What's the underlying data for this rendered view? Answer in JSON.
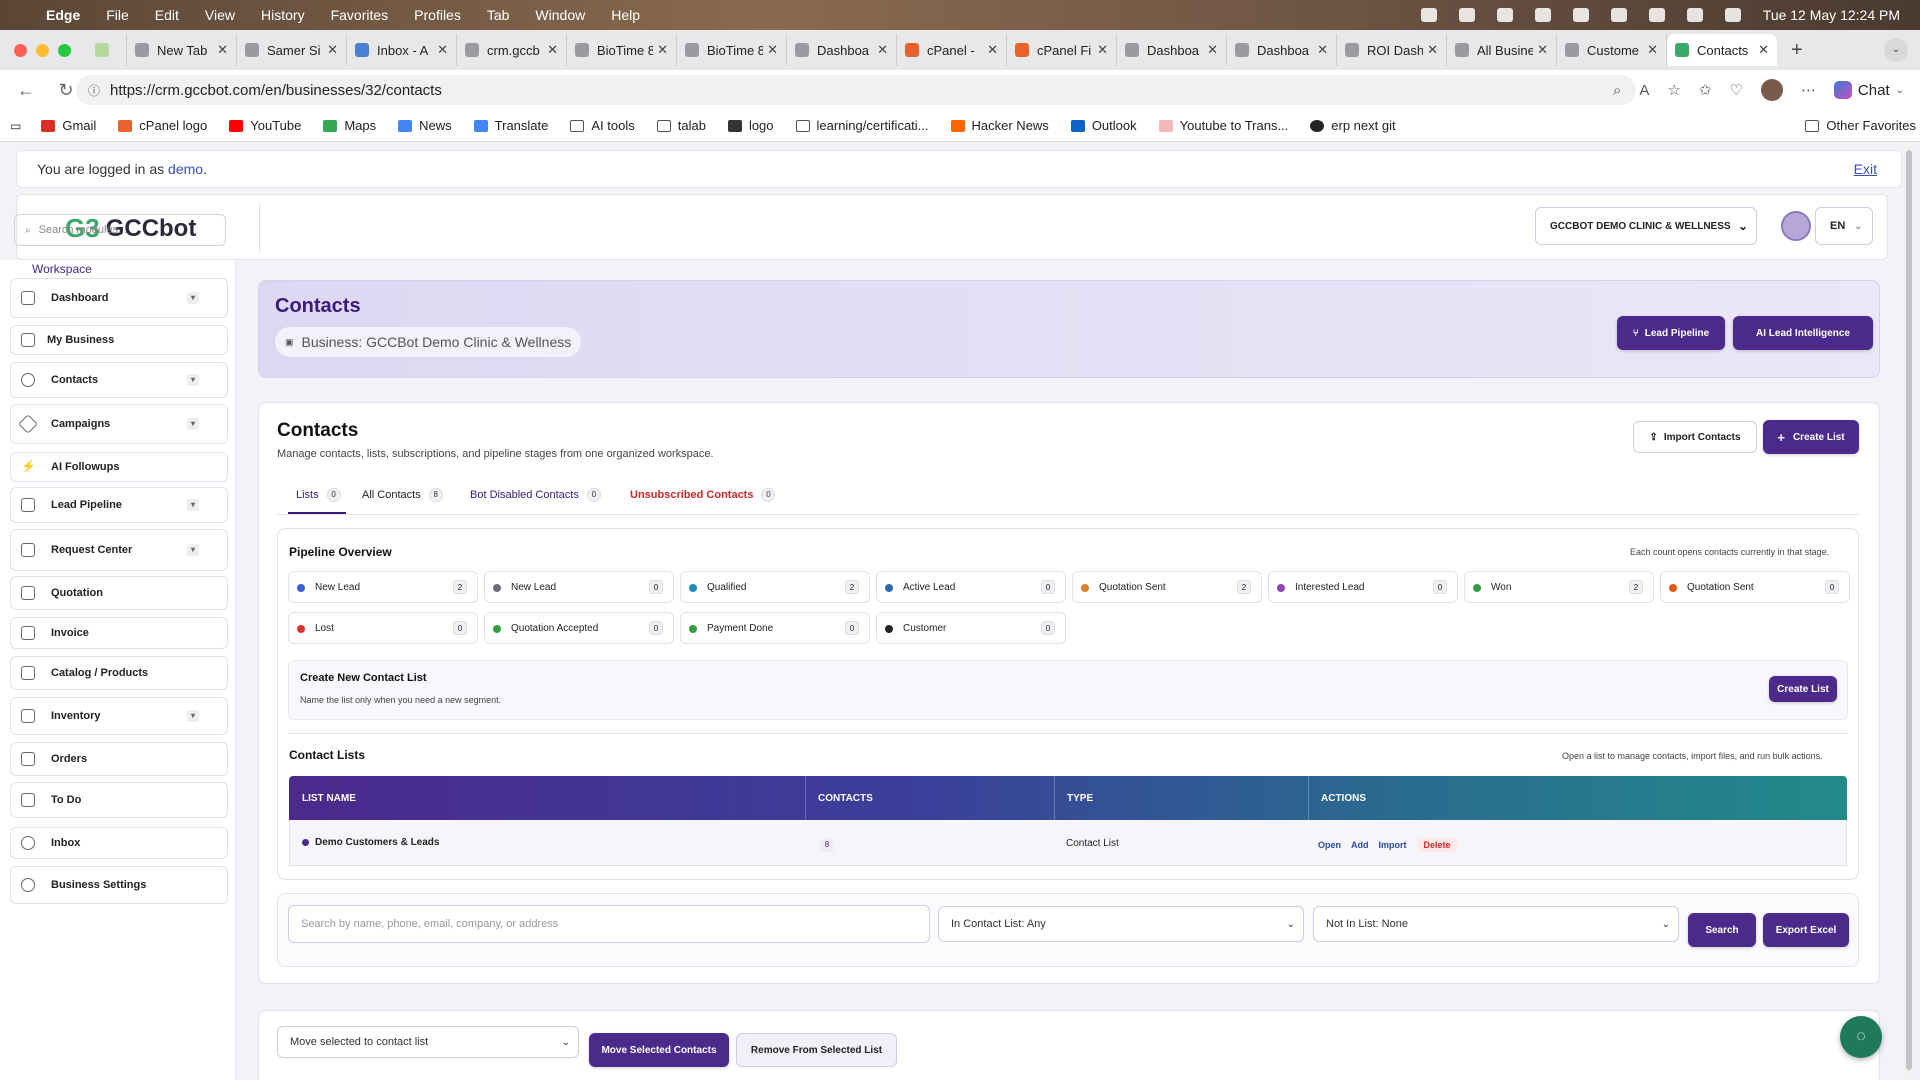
{
  "menubar": {
    "apple": "",
    "app": "Edge",
    "items": [
      "File",
      "Edit",
      "View",
      "History",
      "Favorites",
      "Profiles",
      "Tab",
      "Window",
      "Help"
    ],
    "clock": "Tue 12 May  12:24 PM"
  },
  "tabs": [
    {
      "label": ""
    },
    {
      "label": "New Tab"
    },
    {
      "label": "Samer Si"
    },
    {
      "label": "Inbox - A"
    },
    {
      "label": "crm.gccb"
    },
    {
      "label": "BioTime 8"
    },
    {
      "label": "BioTime 8"
    },
    {
      "label": "Dashboa"
    },
    {
      "label": "cPanel - "
    },
    {
      "label": "cPanel Fi"
    },
    {
      "label": "Dashboa"
    },
    {
      "label": "Dashboa"
    },
    {
      "label": "ROI Dash"
    },
    {
      "label": "All Busine"
    },
    {
      "label": "Custome"
    },
    {
      "label": "Contacts"
    }
  ],
  "address": {
    "url": "https://crm.gccbot.com/en/businesses/32/contacts",
    "chat": "Chat"
  },
  "bookmarks": [
    "Gmail",
    "cPanel logo",
    "YouTube",
    "Maps",
    "News",
    "Translate",
    "AI tools",
    "talab",
    "logo",
    "learning/certificati...",
    "Hacker News",
    "Outlook",
    "Youtube to Trans...",
    "erp next git"
  ],
  "other_favorites": "Other Favorites",
  "login": {
    "prefix": "You are logged in as ",
    "user": "demo",
    "suffix": ".",
    "exit": "Exit"
  },
  "header": {
    "logo_mark": "G3",
    "logo_text": "GCCbot",
    "business_select": "GCCBOT DEMO CLINIC & WELLNESS",
    "lang": "EN"
  },
  "sidebar": {
    "search_placeholder": "Search modules...",
    "workspace": "Workspace",
    "items": [
      {
        "label": "Dashboard",
        "chev": true
      },
      {
        "label": "My Business",
        "chev": false
      },
      {
        "label": "Contacts",
        "chev": true
      },
      {
        "label": "Campaigns",
        "chev": true
      },
      {
        "label": "AI Followups",
        "chev": false
      },
      {
        "label": "Lead Pipeline",
        "chev": true
      },
      {
        "label": "Request Center",
        "chev": true
      },
      {
        "label": "Quotation",
        "chev": false
      },
      {
        "label": "Invoice",
        "chev": false
      },
      {
        "label": "Catalog / Products",
        "chev": false
      },
      {
        "label": "Inventory",
        "chev": true
      },
      {
        "label": "Orders",
        "chev": false
      },
      {
        "label": "To Do",
        "chev": false
      },
      {
        "label": "Inbox",
        "chev": false
      },
      {
        "label": "Business Settings",
        "chev": false
      }
    ]
  },
  "hero": {
    "title": "Contacts",
    "business": "Business: GCCBot Demo Clinic & Wellness",
    "lead_pipeline": "Lead Pipeline",
    "ai_intel": "AI Lead Intelligence"
  },
  "contacts": {
    "title": "Contacts",
    "subtitle": "Manage contacts, lists, subscriptions, and pipeline stages from one organized workspace.",
    "import_btn": "Import Contacts",
    "create_btn": "Create List",
    "tabs": [
      {
        "label": "Lists",
        "count": "0"
      },
      {
        "label": "All Contacts",
        "count": "8"
      },
      {
        "label": "Bot Disabled Contacts",
        "count": "0"
      },
      {
        "label": "Unsubscribed Contacts",
        "count": "0"
      }
    ],
    "pipeline": {
      "title": "Pipeline Overview",
      "note": "Each count opens contacts currently in that stage.",
      "stages": [
        {
          "label": "New Lead",
          "count": "2",
          "color": "#3b5bdb"
        },
        {
          "label": "New Lead",
          "count": "0",
          "color": "#6c6f78"
        },
        {
          "label": "Qualified",
          "count": "2",
          "color": "#1c8fbf"
        },
        {
          "label": "Active Lead",
          "count": "0",
          "color": "#2b6cb0"
        },
        {
          "label": "Quotation Sent",
          "count": "2",
          "color": "#d9822b"
        },
        {
          "label": "Interested Lead",
          "count": "0",
          "color": "#8e44ad"
        },
        {
          "label": "Won",
          "count": "2",
          "color": "#2f9e44"
        },
        {
          "label": "Quotation Sent",
          "count": "0",
          "color": "#e8590c"
        },
        {
          "label": "Lost",
          "count": "0",
          "color": "#e03131"
        },
        {
          "label": "Quotation Accepted",
          "count": "0",
          "color": "#2f9e44"
        },
        {
          "label": "Payment Done",
          "count": "0",
          "color": "#2f9e44"
        },
        {
          "label": "Customer",
          "count": "0",
          "color": "#222222"
        }
      ]
    },
    "create_list": {
      "title": "Create New Contact List",
      "hint": "Name the list only when you need a new segment.",
      "btn": "Create List"
    },
    "lists": {
      "title": "Contact Lists",
      "note": "Open a list to manage contacts, import files, and run bulk actions.",
      "headers": [
        "LIST NAME",
        "CONTACTS",
        "TYPE",
        "ACTIONS"
      ],
      "rows": [
        {
          "name": "Demo Customers & Leads",
          "contacts": "8",
          "type": "Contact List",
          "actions": [
            "Open",
            "Add",
            "Import",
            "Delete"
          ]
        }
      ]
    },
    "filters": {
      "search_placeholder": "Search by name, phone, email, company, or address",
      "in_list": "In Contact List: Any",
      "not_in_list": "Not In List: None",
      "search_btn": "Search",
      "export_btn": "Export Excel"
    },
    "bulk": {
      "move_select": "Move selected to contact list",
      "move_btn": "Move Selected Contacts",
      "remove_btn": "Remove From Selected List"
    }
  }
}
